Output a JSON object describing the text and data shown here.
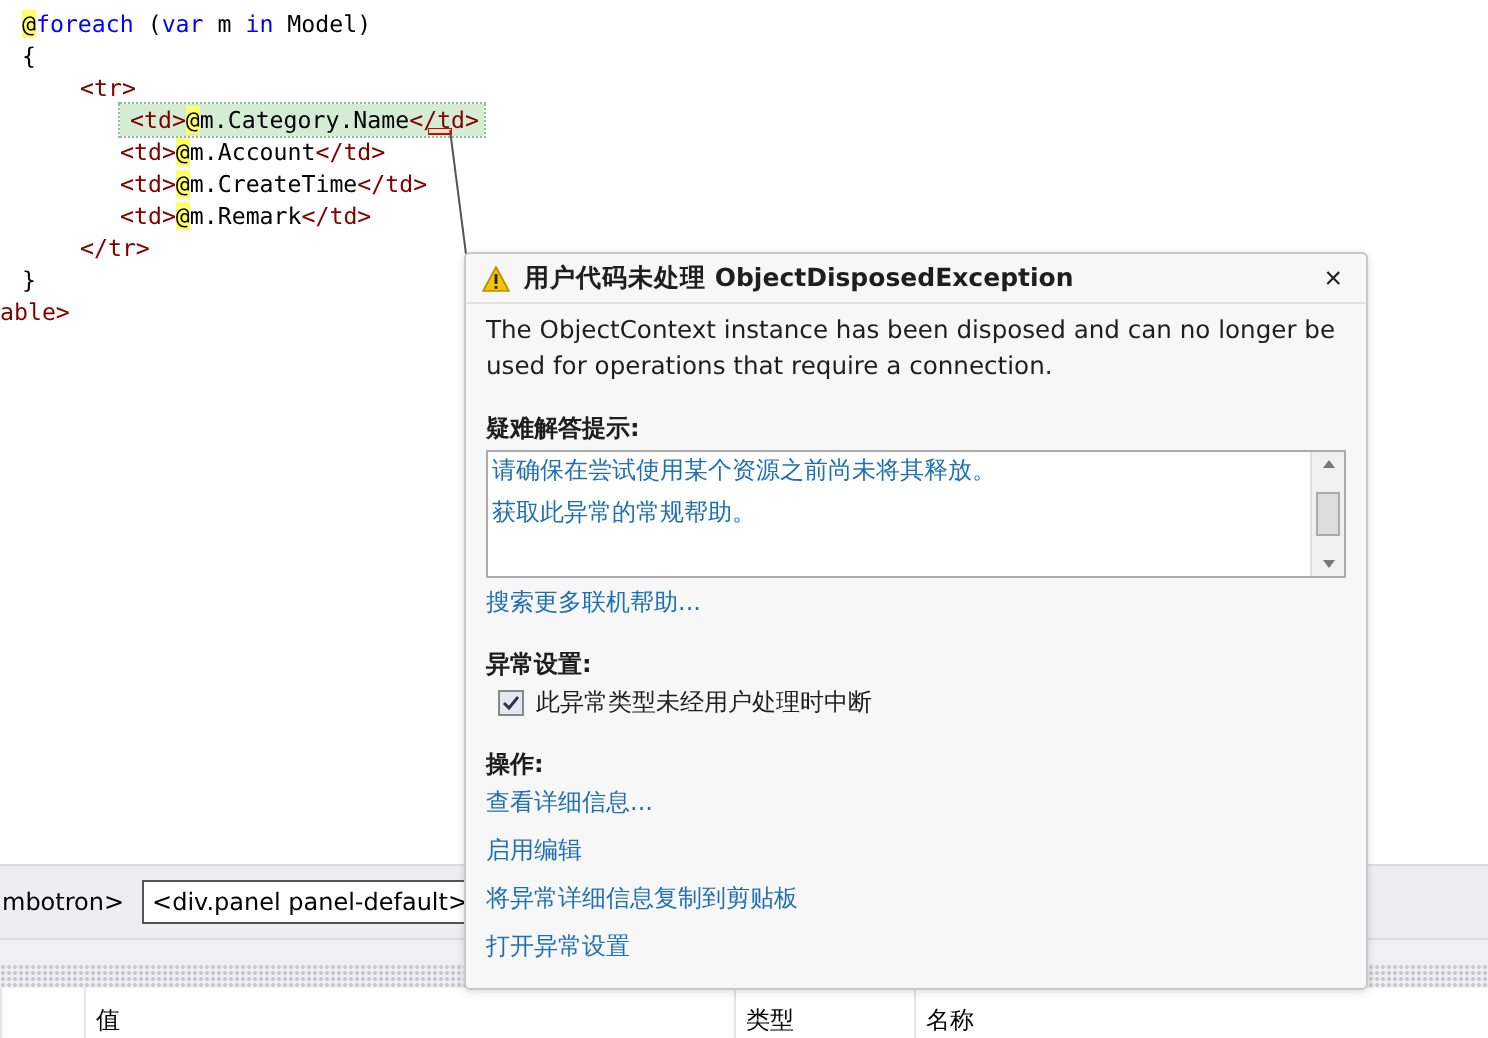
{
  "code_lines": [
    {
      "children": [
        {
          "highlighted": false,
          "segments": [
            {
              "kind": "razor",
              "text": "@"
            },
            {
              "kind": "keyword",
              "text": "foreach"
            },
            {
              "kind": "plain",
              "text": " ("
            },
            {
              "kind": "keyword",
              "text": "var"
            },
            {
              "kind": "plain",
              "text": " m "
            },
            {
              "kind": "keyword",
              "text": "in"
            },
            {
              "kind": "plain",
              "text": " Model)"
            }
          ]
        },
        {
          "highlighted": false,
          "segments": [
            {
              "kind": "plain",
              "text": "{"
            }
          ],
          "children": [
            {
              "highlighted": false,
              "segments": [
                {
                  "kind": "tag",
                  "text": "<tr>"
                }
              ],
              "children": [
                {
                  "highlighted": true,
                  "segments": [
                    {
                      "kind": "tag",
                      "text": "<td>"
                    },
                    {
                      "kind": "razor",
                      "text": "@"
                    },
                    {
                      "kind": "plain",
                      "text": "m.Category.Name"
                    },
                    {
                      "kind": "tag",
                      "text": "</td>"
                    }
                  ]
                },
                {
                  "highlighted": false,
                  "segments": [
                    {
                      "kind": "tag",
                      "text": "<td>"
                    },
                    {
                      "kind": "razor",
                      "text": "@"
                    },
                    {
                      "kind": "plain",
                      "text": "m.Account"
                    },
                    {
                      "kind": "tag",
                      "text": "</td>"
                    }
                  ]
                },
                {
                  "highlighted": false,
                  "segments": [
                    {
                      "kind": "tag",
                      "text": "<td>"
                    },
                    {
                      "kind": "razor",
                      "text": "@"
                    },
                    {
                      "kind": "plain",
                      "text": "m.CreateTime"
                    },
                    {
                      "kind": "tag",
                      "text": "</td>"
                    }
                  ]
                },
                {
                  "highlighted": false,
                  "segments": [
                    {
                      "kind": "tag",
                      "text": "<td>"
                    },
                    {
                      "kind": "razor",
                      "text": "@"
                    },
                    {
                      "kind": "plain",
                      "text": "m.Remark"
                    },
                    {
                      "kind": "tag",
                      "text": "</td>"
                    }
                  ]
                }
              ]
            },
            {
              "highlighted": false,
              "segments": [
                {
                  "kind": "tag",
                  "text": "</tr>"
                }
              ]
            }
          ]
        },
        {
          "highlighted": false,
          "segments": [
            {
              "kind": "plain",
              "text": "}"
            }
          ]
        }
      ]
    },
    {
      "highlighted": false,
      "segments": [
        {
          "kind": "tag",
          "text": "able>"
        }
      ]
    }
  ],
  "breadcrumb": [
    {
      "text": "mbotron>",
      "boxed": false
    },
    {
      "text": "<div.panel panel-default>",
      "boxed": true
    }
  ],
  "table": {
    "columns": [
      "值",
      "类型",
      "名称"
    ]
  },
  "exception_popup": {
    "title": "用户代码未处理 ObjectDisposedException",
    "close": "×",
    "message": "The ObjectContext instance has been disposed and can no longer be used for operations that require a connection.",
    "tips_heading": "疑难解答提示:",
    "tips": [
      "请确保在尝试使用某个资源之前尚未将其释放。",
      "获取此异常的常规帮助。"
    ],
    "search_link": "搜索更多联机帮助...",
    "settings_heading": "异常设置:",
    "setting": {
      "label": "此异常类型未经用户处理时中断",
      "checked": true
    },
    "actions_heading": "操作:",
    "actions": [
      "查看详细信息...",
      "启用编辑",
      "将异常详细信息复制到剪贴板",
      "打开异常设置"
    ]
  }
}
